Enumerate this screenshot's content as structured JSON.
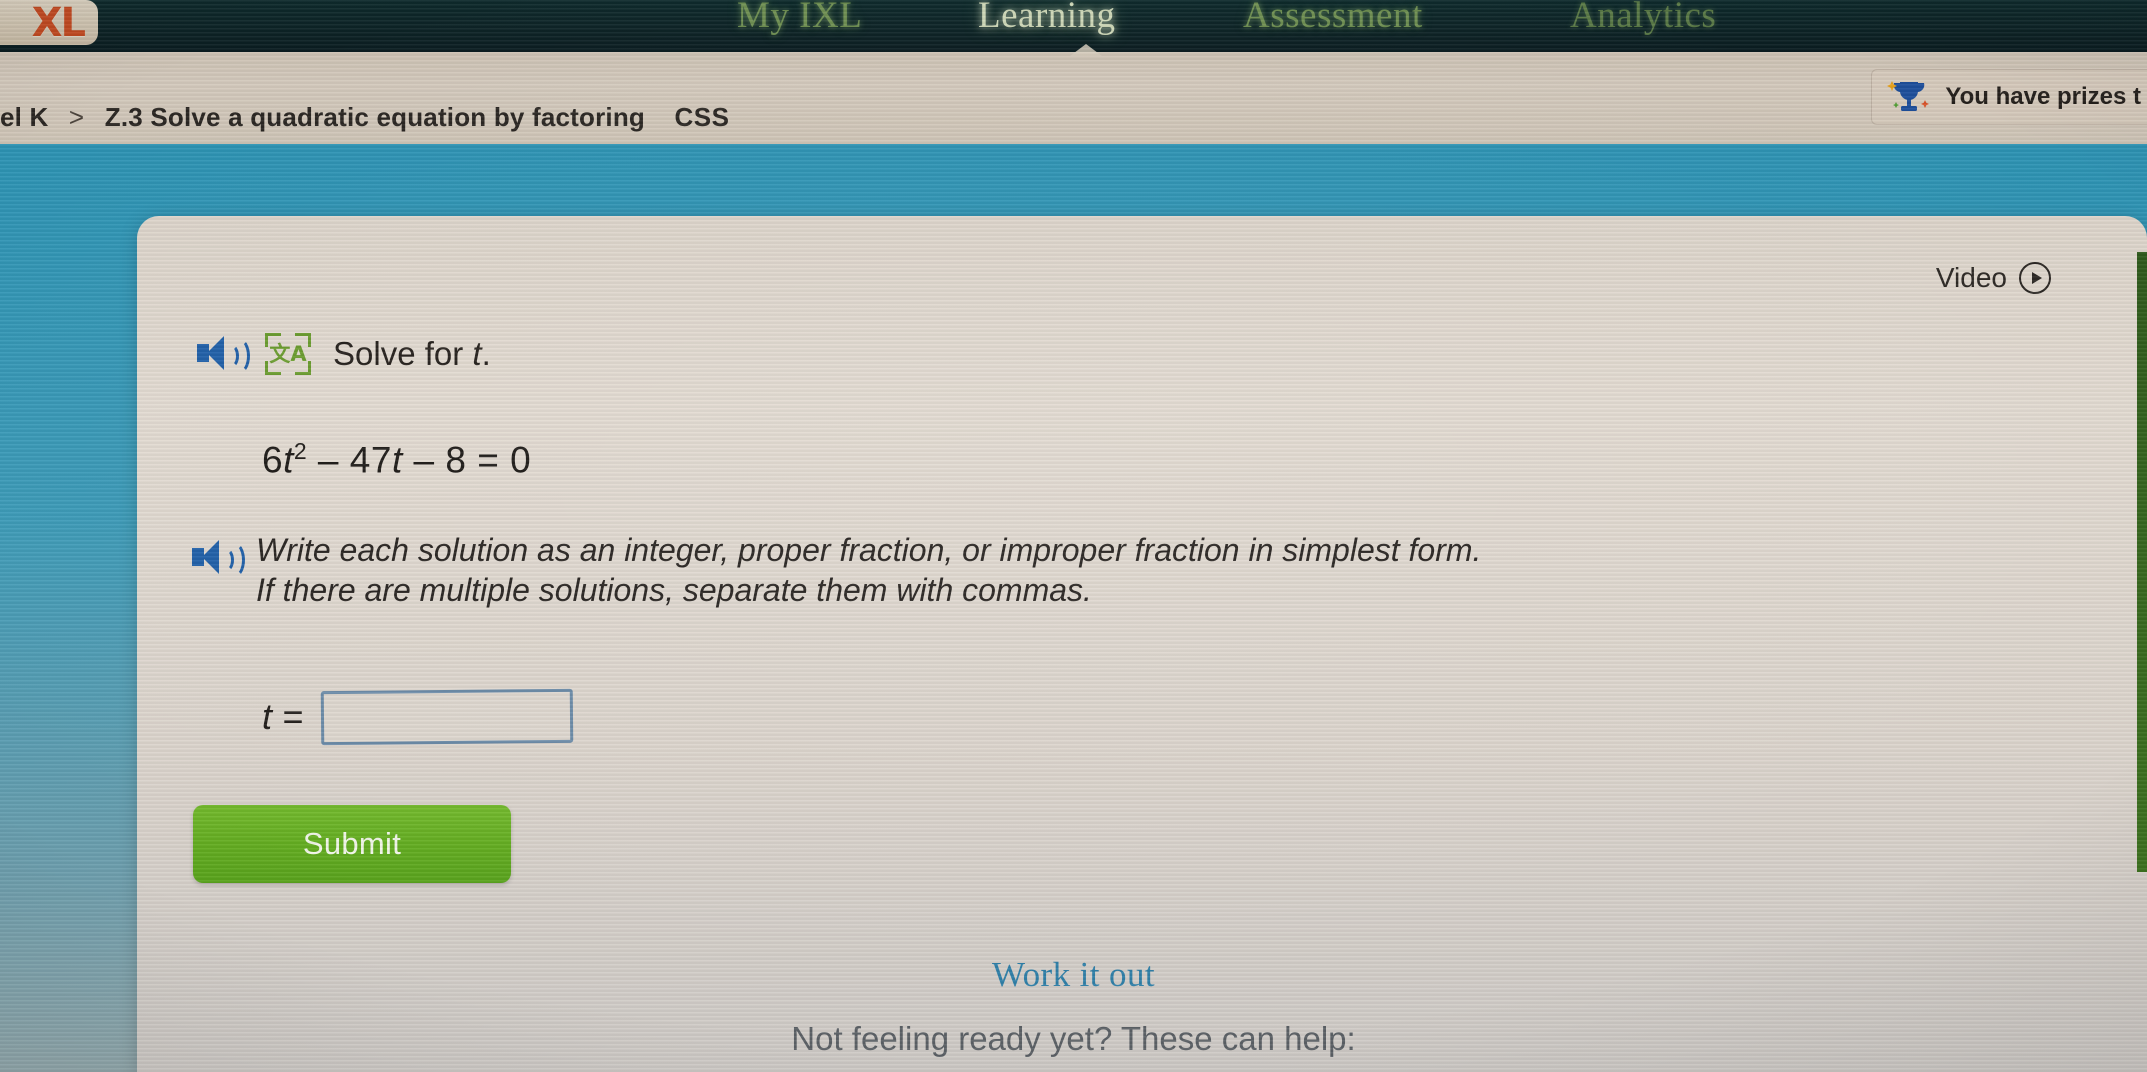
{
  "nav": {
    "logo_text": "XL",
    "logo_icon": "ixl-logo-icon",
    "items": [
      {
        "label": "My IXL",
        "active": false
      },
      {
        "label": "Learning",
        "active": true
      },
      {
        "label": "Assessment",
        "active": false
      },
      {
        "label": "Analytics",
        "active": false
      }
    ]
  },
  "breadcrumb": {
    "level": "el K",
    "separator": ">",
    "skill": "Z.3 Solve a quadratic equation by factoring",
    "skill_code": "CSS"
  },
  "prizes": {
    "label": "You have prizes t",
    "icon": "trophy-icon"
  },
  "card": {
    "video_label": "Video",
    "video_icon": "play-circle-icon",
    "audio_icon": "speaker-icon",
    "translate_icon": "translate-icon",
    "translate_glyph": "文A",
    "prompt": "Solve for ",
    "prompt_var": "t",
    "prompt_end": ".",
    "equation": {
      "coefficient": "6",
      "variable": "t",
      "exponent": "2",
      "term2": " – 47",
      "variable2": "t",
      "term3": " – 8 = 0",
      "full": "6t² – 47t – 8 = 0"
    },
    "instructions_line1": "Write each solution as an integer, proper fraction, or improper fraction in simplest form.",
    "instructions_line2": "If there are multiple solutions, separate them with commas.",
    "answer_label": "t =",
    "answer_value": "",
    "answer_placeholder": "",
    "submit_label": "Submit"
  },
  "footer": {
    "work_it_out": "Work it out",
    "ready_help": "Not feeling ready yet? These can help:"
  },
  "colors": {
    "nav_background": "#0d2326",
    "nav_link": "#6f8f52",
    "nav_link_active": "#cfd8b8",
    "page_background": "#3c9bb8",
    "card_background": "#e3dbd2",
    "submit_green": "#63ad20",
    "link_blue": "#2f7fa8",
    "input_border": "#6b8ba8",
    "speaker_blue": "#1f5fa8",
    "translate_green": "#6a9c2e",
    "logo_orange": "#c14a22"
  }
}
